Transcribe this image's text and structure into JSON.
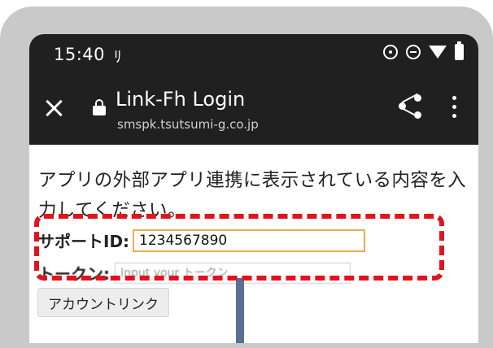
{
  "status_bar": {
    "time": "15:40",
    "extra_icon_text": "ﾘ"
  },
  "app_bar": {
    "title": "Link-Fh Login",
    "url": "smspk.tsutsumi-g.co.jp",
    "icons": [
      "close-icon",
      "lock-icon",
      "share-icon",
      "more-icon"
    ]
  },
  "content": {
    "instruction": "アプリの外部アプリ連携に表示されている内容を入力してください。",
    "support_id_label": "サポートID:",
    "support_id_value": "1234567890",
    "token_label": "トークン:",
    "token_placeholder": "Input your トークン",
    "account_link_button": "アカウントリンク"
  },
  "colors": {
    "highlight": "#e2131c",
    "input_focus_border": "#e5b04a",
    "app_bar_bg": "#202020",
    "frame": "#c9c9c9"
  }
}
